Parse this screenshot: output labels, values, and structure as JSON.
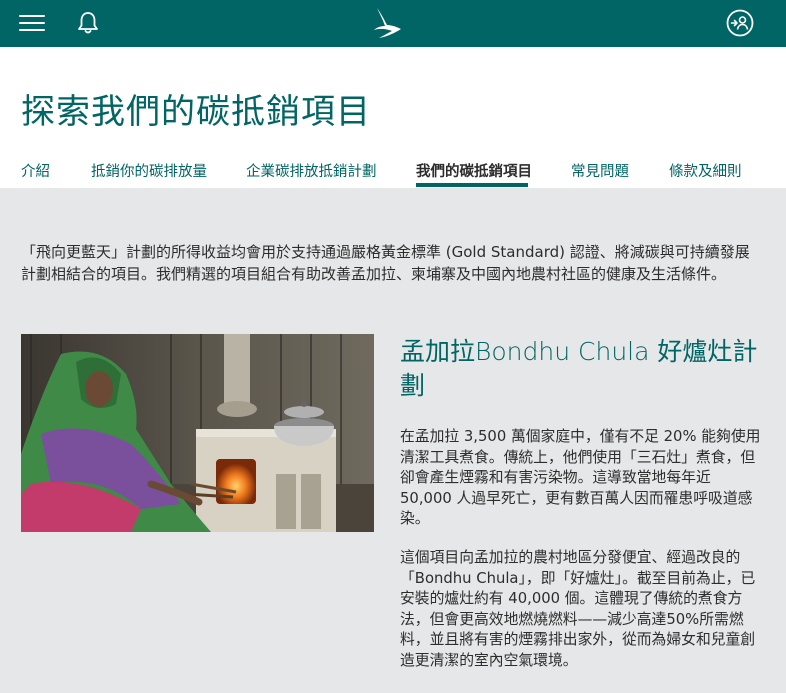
{
  "header": {
    "menu_icon": "hamburger-menu-icon",
    "notification_icon": "bell-icon",
    "logo_icon": "cathay-brushwing-logo",
    "login_icon": "user-login-icon"
  },
  "page": {
    "title": "探索我們的碳抵銷項目"
  },
  "tabs": [
    {
      "label": "介紹"
    },
    {
      "label": "抵銷你的碳排放量"
    },
    {
      "label": "企業碳排放抵銷計劃"
    },
    {
      "label": "我們的碳抵銷項目"
    },
    {
      "label": "常見問題"
    },
    {
      "label": "條款及細則"
    }
  ],
  "intro": {
    "text": "「飛向更藍天」計劃的所得收益均會用於支持通過嚴格黃金標準 (Gold Standard) 認證、將減碳與可持續發展計劃相結合的項目。我們精選的項目組合有助改善孟加拉、柬埔寨及中國內地農村社區的健康及生活條件。"
  },
  "project": {
    "title": "孟加拉Bondhu Chula 好爐灶計劃",
    "paragraph1": "在孟加拉 3,500 萬個家庭中，僅有不足 20% 能夠使用清潔工具煮食。傳統上，他們使用「三石灶」煮食，但卻會產生煙霧和有害污染物。這導致當地每年近 50,000 人過早死亡，更有數百萬人因而罹患呼吸道感染。",
    "paragraph2": "這個項目向孟加拉的農村地區分發便宜、經過改良的「Bondhu Chula」，即「好爐灶」。截至目前為止，已安裝的爐灶約有 40,000 個。這體現了傳統的煮食方法，但會更高效地燃燒燃料——減少高達50%所需燃料，並且將有害的煙霧排出家外，從而為婦女和兒童創造更清潔的室內空氣環境。"
  },
  "colors": {
    "brand": "#006564",
    "background": "#e6e7e8",
    "text": "#2d2d2d"
  }
}
